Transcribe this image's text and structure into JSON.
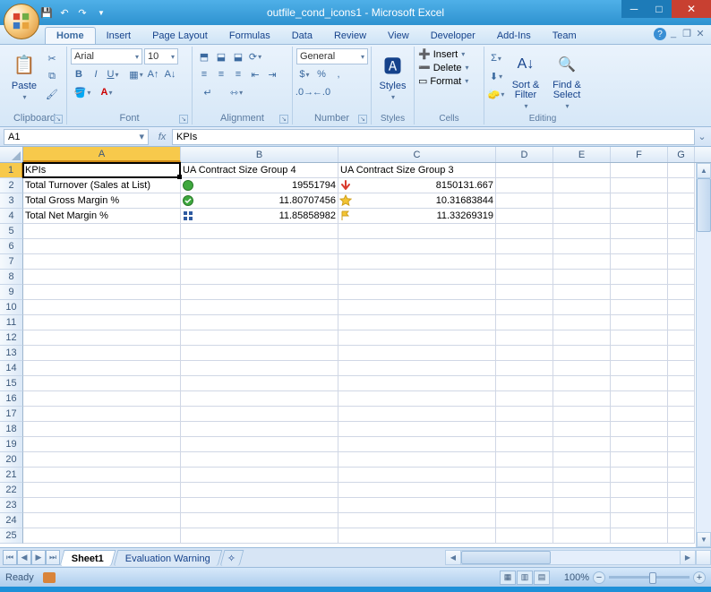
{
  "window": {
    "title": "outfile_cond_icons1 - Microsoft Excel"
  },
  "tabs": {
    "home": "Home",
    "insert": "Insert",
    "pagelayout": "Page Layout",
    "formulas": "Formulas",
    "data": "Data",
    "review": "Review",
    "view": "View",
    "developer": "Developer",
    "addins": "Add-Ins",
    "team": "Team"
  },
  "ribbon": {
    "clipboard": {
      "paste": "Paste",
      "label": "Clipboard"
    },
    "font": {
      "name": "Arial",
      "size": "10",
      "label": "Font"
    },
    "alignment": {
      "label": "Alignment"
    },
    "number": {
      "format": "General",
      "label": "Number"
    },
    "styles": {
      "styles": "Styles",
      "label": "Styles"
    },
    "cells": {
      "insert": "Insert",
      "delete": "Delete",
      "format": "Format",
      "label": "Cells"
    },
    "editing": {
      "sort": "Sort & Filter",
      "find": "Find & Select",
      "label": "Editing"
    }
  },
  "namebox": {
    "ref": "A1",
    "formula": "KPIs"
  },
  "columns": {
    "A": "A",
    "B": "B",
    "C": "C",
    "D": "D",
    "E": "E",
    "F": "F",
    "G": "G"
  },
  "colwidths": {
    "A": 176,
    "B": 176,
    "C": 176,
    "D": 64,
    "E": 64,
    "F": 64,
    "G": 30
  },
  "data": {
    "r1": {
      "A": "KPIs",
      "B": "UA Contract Size Group 4",
      "C": "UA Contract Size Group 3"
    },
    "r2": {
      "A": "Total Turnover (Sales at List)",
      "B": "19551794",
      "C": "8150131.667",
      "iconB": "green-circle",
      "iconC": "red-down-arrow"
    },
    "r3": {
      "A": "Total Gross Margin %",
      "B": "11.80707456",
      "C": "10.31683844",
      "iconB": "green-check",
      "iconC": "yellow-star"
    },
    "r4": {
      "A": "Total Net Margin %",
      "B": "11.85858982",
      "C": "11.33269319",
      "iconB": "four-squares",
      "iconC": "yellow-flag"
    }
  },
  "sheettabs": {
    "s1": "Sheet1",
    "s2": "Evaluation Warning"
  },
  "status": {
    "ready": "Ready",
    "zoom": "100%"
  }
}
